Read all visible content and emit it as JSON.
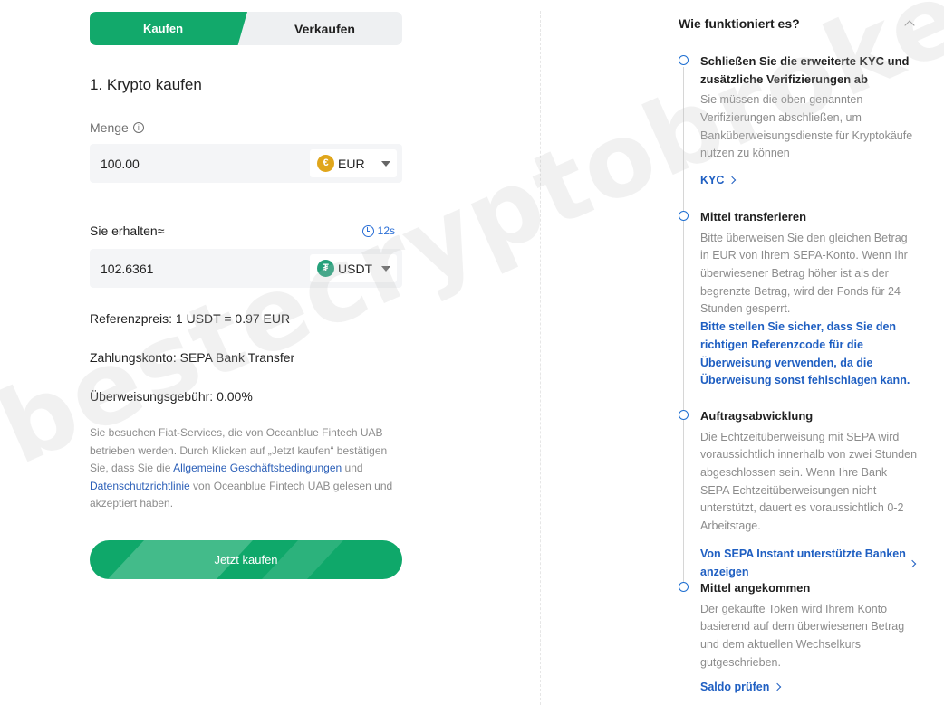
{
  "tabs": {
    "buy": "Kaufen",
    "sell": "Verkaufen"
  },
  "step_title": "1. Krypto kaufen",
  "amount": {
    "label": "Menge",
    "value": "100.00",
    "currency": "EUR",
    "info_glyph": "i"
  },
  "receive": {
    "label": "Sie erhalten≈",
    "timer": "12s",
    "value": "102.6361",
    "currency": "USDT"
  },
  "info": {
    "ref_price": "Referenzpreis: 1 USDT = 0.97 EUR",
    "pay_account": "Zahlungskonto: SEPA Bank Transfer",
    "fee": "Überweisungsgebühr: 0.00%"
  },
  "disclaimer": {
    "p1": "Sie besuchen Fiat-Services, die von Oceanblue Fintech UAB betrieben werden. Durch Klicken auf „Jetzt kaufen“ bestätigen Sie, dass Sie die ",
    "link1": "Allgemeine Geschäftsbedingungen",
    "p2": " und ",
    "link2": "Datenschutzrichtlinie",
    "p3": " von Oceanblue Fintech UAB gelesen und akzeptiert haben."
  },
  "cta": "Jetzt kaufen",
  "how": {
    "title": "Wie funktioniert es?",
    "steps": [
      {
        "title": "Schließen Sie die erweiterte KYC und zusätzliche Verifizierungen ab",
        "desc": "Sie müssen die oben genannten Verifizierungen abschließen, um Banküberweisungsdienste für Kryptokäufe nutzen zu können",
        "link": "KYC"
      },
      {
        "title": "Mittel transferieren",
        "desc": "Bitte überweisen Sie den gleichen Betrag in EUR von Ihrem SEPA-Konto. Wenn Ihr überwiesener Betrag höher ist als der begrenzte Betrag, wird der Fonds für 24 Stunden gesperrt.",
        "bold": "Bitte stellen Sie sicher, dass Sie den richtigen Referenzcode für die Überweisung verwenden, da die Überweisung sonst fehlschlagen kann."
      },
      {
        "title": "Auftragsabwicklung",
        "desc": "Die Echtzeitüberweisung mit SEPA wird voraussichtlich innerhalb von zwei Stunden abgeschlossen sein. Wenn Ihre Bank SEPA Echtzeitüberweisungen nicht unterstützt, dauert es voraussichtlich 0-2 Arbeitstage.",
        "link": "Von SEPA Instant unterstützte Banken anzeigen"
      },
      {
        "title": "Mittel angekommen",
        "desc": "Der gekaufte Token wird Ihrem Konto basierend auf dem überwiesenen Betrag und dem aktuellen Wechselkurs gutgeschrieben.",
        "link": "Saldo prüfen"
      }
    ]
  },
  "watermark": "bestecryptobroker.hn.de",
  "colors": {
    "green": "#12a96b",
    "blue": "#1f5fc2",
    "eur_coin": "#e0a61b",
    "usdt_coin": "#26a17b"
  }
}
